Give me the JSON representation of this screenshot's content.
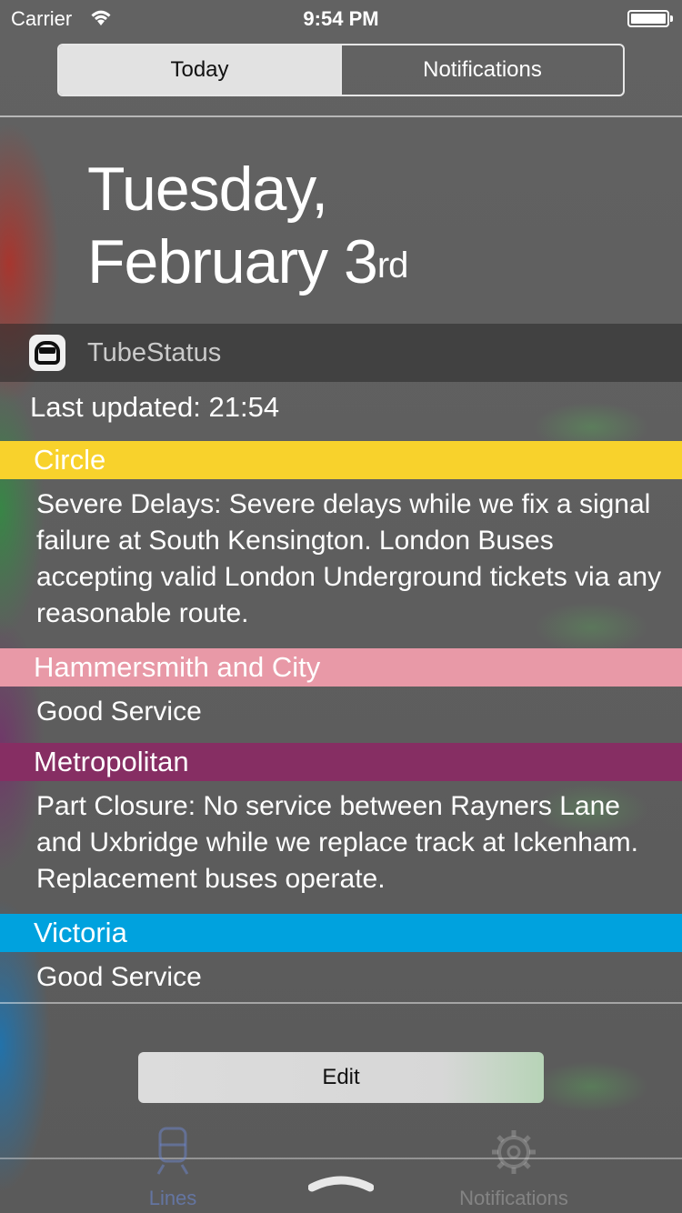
{
  "status_bar": {
    "carrier": "Carrier",
    "time": "9:54 PM"
  },
  "segments": {
    "today": "Today",
    "notifications": "Notifications"
  },
  "date": {
    "weekday": "Tuesday,",
    "month_day": "February 3",
    "suffix": "rd"
  },
  "widget": {
    "app_name": "TubeStatus",
    "last_updated": "Last updated: 21:54",
    "lines": [
      {
        "name": "Circle",
        "color": "#F8D22C",
        "status": "Severe Delays: Severe delays while we fix a signal failure at South Kensington. London Buses accepting valid London Underground tickets via any reasonable route."
      },
      {
        "name": "Hammersmith and City",
        "color": "#E899A7",
        "status": "Good Service"
      },
      {
        "name": "Metropolitan",
        "color": "#862E63",
        "status": "Part Closure: No service between Rayners Lane and Uxbridge while we replace track at Ickenham. Replacement buses operate."
      },
      {
        "name": "Victoria",
        "color": "#00A2DE",
        "status": "Good Service"
      }
    ],
    "edit_label": "Edit"
  },
  "tab_bar": {
    "lines_label": "Lines",
    "notifications_label": "Notifications"
  },
  "icons": {
    "wifi": "wifi-icon",
    "battery": "battery-icon",
    "app": "train-icon",
    "lines_tab": "train-icon",
    "notifications_tab": "gear-icon",
    "grabber": "grabber-icon"
  }
}
